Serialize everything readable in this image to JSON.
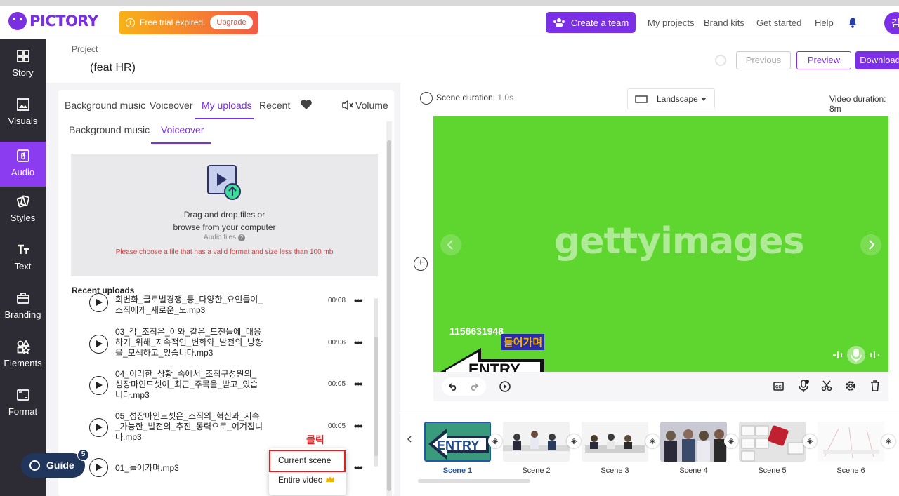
{
  "header": {
    "logo_text": "PICTORY",
    "trial_text": "Free trial expired.",
    "upgrade_label": "Upgrade",
    "create_team_label": "Create a team",
    "nav": [
      "My projects",
      "Brand kits",
      "Get started",
      "Help"
    ],
    "avatar_initial": "김"
  },
  "sidebar": {
    "items": [
      {
        "label": "Story",
        "icon": "story-icon"
      },
      {
        "label": "Visuals",
        "icon": "image-icon"
      },
      {
        "label": "Audio",
        "icon": "music-icon",
        "active": true
      },
      {
        "label": "Styles",
        "icon": "styles-icon"
      },
      {
        "label": "Text",
        "icon": "text-icon"
      },
      {
        "label": "Branding",
        "icon": "briefcase-icon"
      },
      {
        "label": "Elements",
        "icon": "elements-icon"
      },
      {
        "label": "Format",
        "icon": "format-icon"
      }
    ]
  },
  "project": {
    "label": "Project",
    "name": "(feat HR)",
    "previous_label": "Previous",
    "preview_label": "Preview",
    "download_label": "Download"
  },
  "audio_panel": {
    "tabs": [
      "Background music",
      "Voiceover",
      "My uploads",
      "Recent"
    ],
    "volume_label": "Volume",
    "subtabs": [
      "Background music",
      "Voiceover"
    ],
    "drop_line1": "Drag and drop files or",
    "drop_line2": "browse from your computer",
    "audio_files_label": "Audio files",
    "error_text": "Please choose a file that has a valid format and size less than 100 mb",
    "recent_title": "Recent uploads",
    "uploads": [
      {
        "name": "회변화_글로벌경쟁_등_다양한_요인들이_조직에게_새로운_도.mp3",
        "duration": "00:08"
      },
      {
        "name": "03_각_조직은_이와_같은_도전들에_대응하기_위해_지속적인_변화와_발전의_방향을_모색하고_있습니다.mp3",
        "duration": "00:06"
      },
      {
        "name": "04_이러한_상황_속에서_조직구성원의_성장마인드셋이_최근_주목을_받고_있습니다.mp3",
        "duration": "00:05"
      },
      {
        "name": "05_성장마인드셋은_조직의_혁신과_지속_가능한_발전의_추진_동력으로_여겨집니다.mp3",
        "duration": "00:05"
      },
      {
        "name": "01_들어가며.mp3",
        "duration": ""
      }
    ],
    "context_menu": {
      "current_scene": "Current scene",
      "entire_video": "Entire video"
    },
    "annotation": "클릭"
  },
  "guide": {
    "label": "Guide",
    "count": "5"
  },
  "editor": {
    "scene_duration_label": "Scene duration:",
    "scene_duration_value": "1.0s",
    "orientation": "Landscape",
    "video_duration_label": "Video duration: 8m",
    "watermark": "gettyimages",
    "stock_id": "1156631948",
    "overlay_text": "들어가며",
    "entry_text": "ENTRY"
  },
  "timeline": {
    "scenes": [
      "Scene 1",
      "Scene 2",
      "Scene 3",
      "Scene 4",
      "Scene 5",
      "Scene 6"
    ]
  },
  "colors": {
    "brand": "#7b2fe6",
    "sidebar": "#2d2c35",
    "canvas": "#5fd62f",
    "annotation": "#e02020"
  }
}
